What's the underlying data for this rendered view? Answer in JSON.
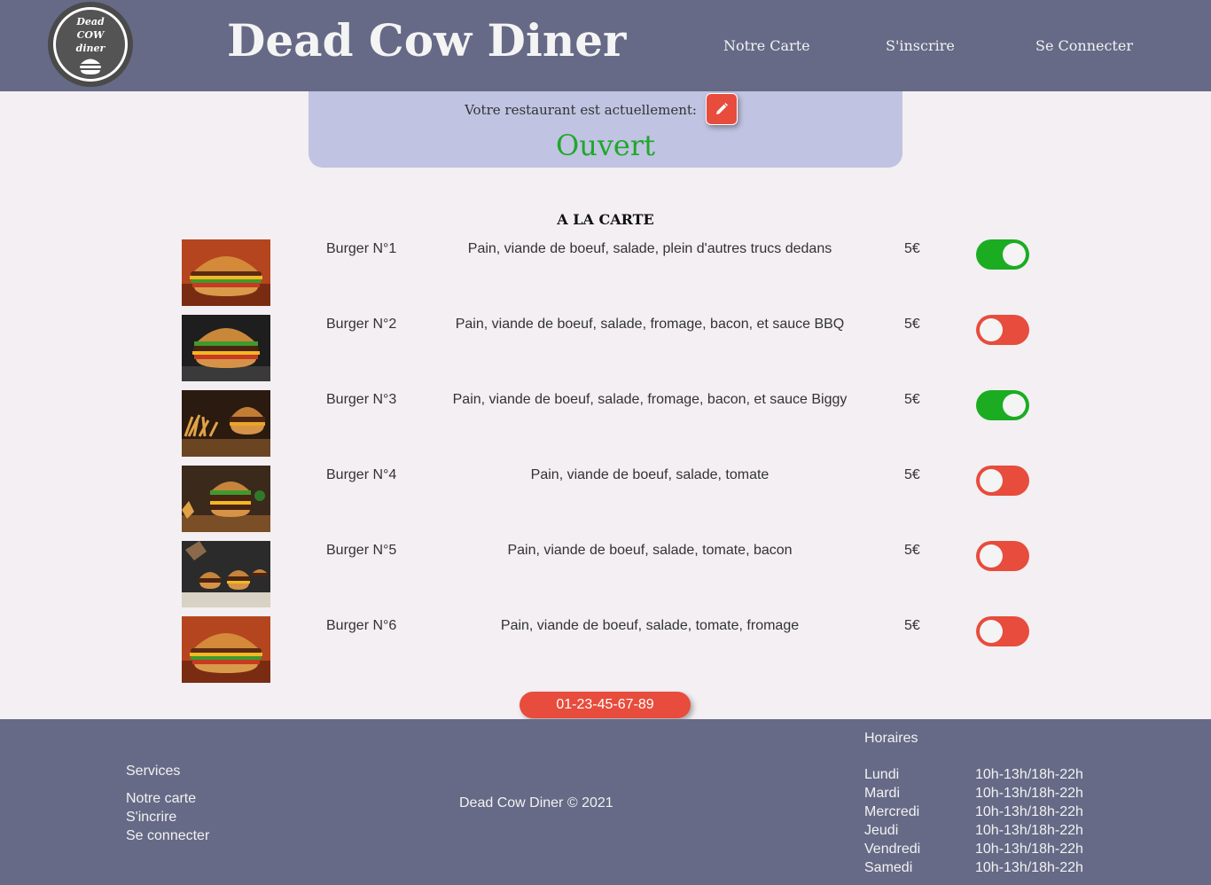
{
  "header": {
    "logo_text": [
      "Dead",
      "COW",
      "diner"
    ],
    "title": "Dead Cow Diner",
    "nav": [
      "Notre Carte",
      "S'inscrire",
      "Se Connecter"
    ]
  },
  "status": {
    "label": "Votre restaurant est actuellement:",
    "value": "Ouvert",
    "edit_icon": "pencil-icon"
  },
  "menu": {
    "title": "A LA CARTE",
    "items": [
      {
        "name": "Burger N°1",
        "description": "Pain, viande de boeuf, salade, plein d'autres trucs dedans",
        "price": "5€",
        "available": true
      },
      {
        "name": "Burger N°2",
        "description": "Pain, viande de boeuf, salade, fromage, bacon, et sauce BBQ",
        "price": "5€",
        "available": false
      },
      {
        "name": "Burger N°3",
        "description": "Pain, viande de boeuf, salade, fromage, bacon, et sauce Biggy",
        "price": "5€",
        "available": true
      },
      {
        "name": "Burger N°4",
        "description": "Pain, viande de boeuf, salade, tomate",
        "price": "5€",
        "available": false
      },
      {
        "name": "Burger N°5",
        "description": "Pain, viande de boeuf, salade, tomate, bacon",
        "price": "5€",
        "available": false
      },
      {
        "name": "Burger N°6",
        "description": "Pain, viande de boeuf, salade, tomate, fromage",
        "price": "5€",
        "available": false
      }
    ]
  },
  "phone": "01-23-45-67-89",
  "footer": {
    "services_title": "Services",
    "services": [
      "Notre carte",
      "S'incrire",
      "Se connecter"
    ],
    "copyright": "Dead Cow Diner © 2021",
    "hours_title": "Horaires",
    "hours": [
      {
        "day": "Lundi",
        "time": "10h-13h/18h-22h"
      },
      {
        "day": "Mardi",
        "time": "10h-13h/18h-22h"
      },
      {
        "day": "Mercredi",
        "time": "10h-13h/18h-22h"
      },
      {
        "day": "Jeudi",
        "time": "10h-13h/18h-22h"
      },
      {
        "day": "Vendredi",
        "time": "10h-13h/18h-22h"
      },
      {
        "day": "Samedi",
        "time": "10h-13h/18h-22h"
      }
    ]
  },
  "colors": {
    "header_bg": "#666a86",
    "status_bg": "#c0c3e1",
    "open_green": "#1fa82a",
    "toggle_on": "#1bac22",
    "accent_red": "#e74c3c",
    "page_bg": "#f3eff3"
  }
}
